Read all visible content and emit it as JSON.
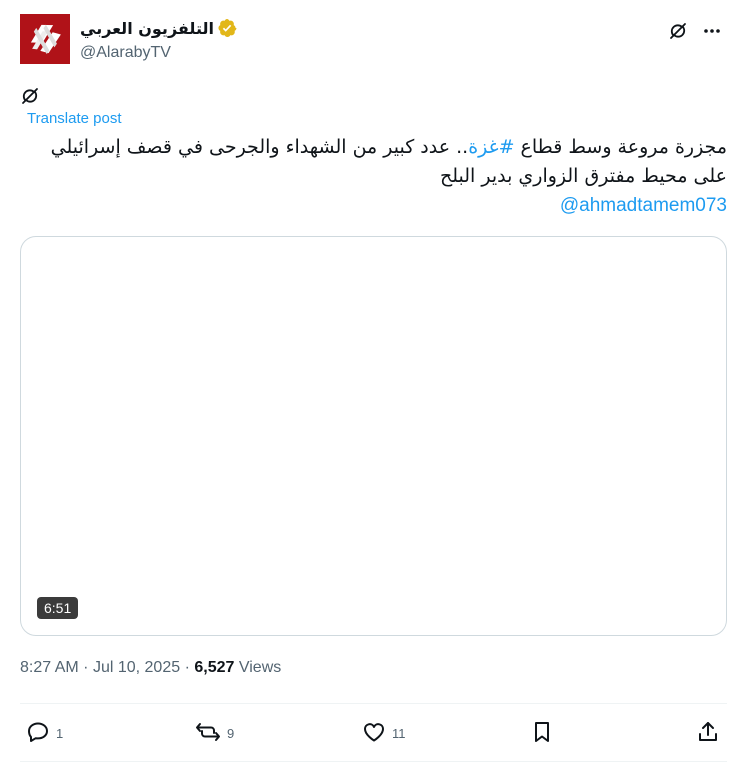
{
  "author": {
    "display_name": "التلفزيون العربي",
    "handle": "@AlarabyTV"
  },
  "header_icons": [
    "grok-icon",
    "more-icon"
  ],
  "translate_label": "Translate post",
  "post": {
    "line1_before": "مجزرة مروعة وسط قطاع ",
    "hashtag": "#غزة",
    "line1_after": ".. عدد كبير من الشهداء والجرحى في قصف إسرائيلي",
    "line2": "على محيط مفترق الزواري بدير البلح",
    "mention": "@ahmadtamem073"
  },
  "media": {
    "duration": "6:51"
  },
  "meta": {
    "time": "8:27 AM",
    "date": "Jul 10, 2025",
    "views_count": "6,527",
    "views_label": "Views"
  },
  "actions": {
    "replies": "1",
    "reposts": "9",
    "likes": "11"
  },
  "colors": {
    "accent": "#1d9bf0",
    "secondary_text": "#536471",
    "verified_gold": "#e2b719",
    "avatar_red": "#b01218"
  }
}
